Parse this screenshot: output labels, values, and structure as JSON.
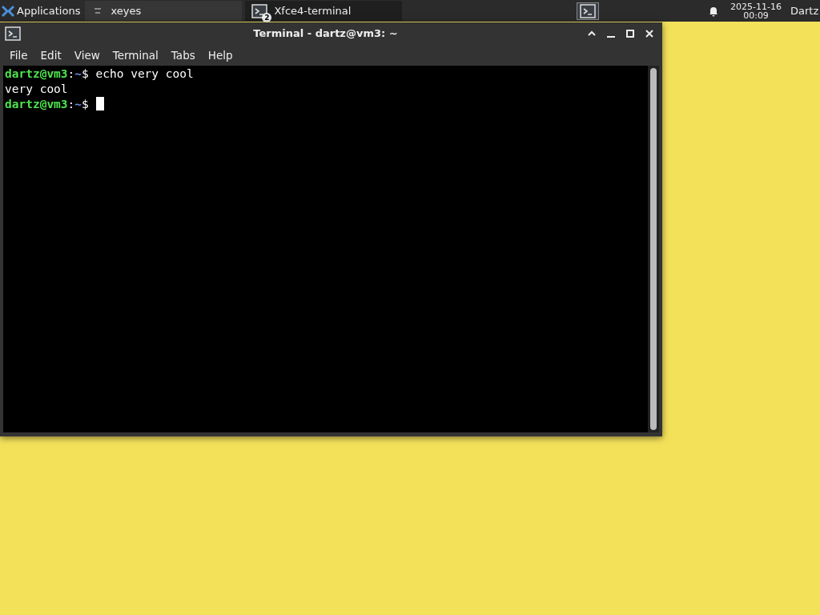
{
  "panel": {
    "menu_label": "Applications",
    "tasks": [
      {
        "label": "xeyes",
        "selected": false
      },
      {
        "label": "Xfce4-terminal",
        "selected": true,
        "count": "2"
      }
    ],
    "clock": {
      "date": "2025-11-16",
      "time": "00:09"
    },
    "user": "Dartz"
  },
  "window": {
    "title": "Terminal - dartz@vm3: ~",
    "menu": [
      "File",
      "Edit",
      "View",
      "Terminal",
      "Tabs",
      "Help"
    ],
    "lines": [
      {
        "kind": "prompt",
        "user": "dartz@vm3",
        "sep": ":",
        "path": "~",
        "sign": "$",
        "command": "echo very cool"
      },
      {
        "kind": "output",
        "text": "very cool"
      },
      {
        "kind": "prompt",
        "user": "dartz@vm3",
        "sep": ":",
        "path": "~",
        "sign": "$",
        "cursor": true
      }
    ]
  }
}
